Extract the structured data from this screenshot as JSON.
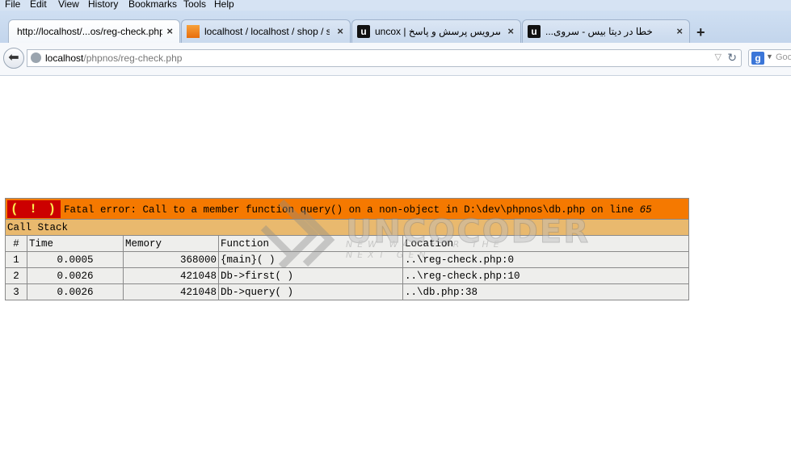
{
  "menu": [
    "File",
    "Edit",
    "View",
    "History",
    "Bookmarks",
    "Tools",
    "Help"
  ],
  "tabs": [
    {
      "title": "http://localhost/...os/reg-check.php",
      "active": true,
      "icon": "none"
    },
    {
      "title": "localhost / localhost / shop / s...",
      "active": false,
      "icon": "phpmyadmin-icon"
    },
    {
      "title": "uncox | سرویس پرسش و پاسخ",
      "active": false,
      "icon": "uncox-icon"
    },
    {
      "title": "...خطا در دیتا بیس - سروی",
      "active": false,
      "icon": "uncox-icon"
    }
  ],
  "icons": {
    "close": "×",
    "new_tab": "+",
    "back": "⬅",
    "reload": "↻",
    "dropdown": "▽"
  },
  "navbar": {
    "url_host": "localhost",
    "url_path": "/phpnos/reg-check.php",
    "search_text": "Goo"
  },
  "error": {
    "badge": "( ! )",
    "message": "Fatal error: Call to a member function query() on a non-object in D:\\dev\\phpnos\\db.php on line ",
    "line": "65",
    "call_stack_title": "Call Stack",
    "columns": [
      "#",
      "Time",
      "Memory",
      "Function",
      "Location"
    ],
    "rows": [
      [
        "1",
        "0.0005",
        "368000",
        "{main}( )",
        "..\\reg-check.php:0"
      ],
      [
        "2",
        "0.0026",
        "421048",
        "Db->first( )",
        "..\\reg-check.php:10"
      ],
      [
        "3",
        "0.0026",
        "421048",
        "Db->query( )",
        "..\\db.php:38"
      ]
    ]
  },
  "watermark": {
    "brand": "UNCOCODER",
    "tagline": "NEW WAY FOR THE NEXT GEN"
  },
  "colors": {
    "error_header": "#f57900",
    "badge_bg": "#cc0000",
    "stack_header": "#e9b96e",
    "row_bg": "#eeeeec"
  }
}
